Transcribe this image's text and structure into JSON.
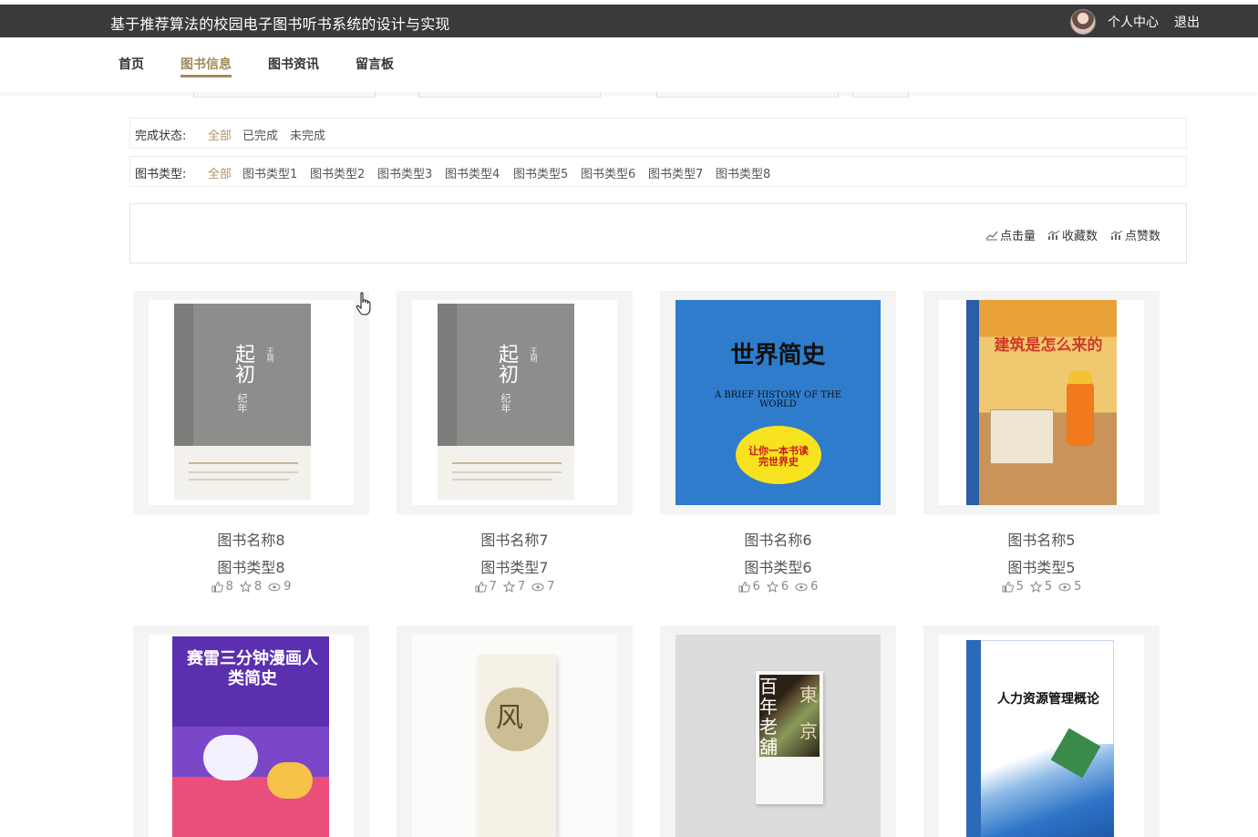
{
  "header": {
    "title": "基于推荐算法的校园电子图书听书系统的设计与实现",
    "user_center": "个人中心",
    "logout": "退出"
  },
  "nav": {
    "items": [
      "首页",
      "图书信息",
      "图书资讯",
      "留言板"
    ],
    "active": "图书信息"
  },
  "filters": {
    "status": {
      "label": "完成状态:",
      "options": [
        "全部",
        "已完成",
        "未完成"
      ],
      "selected": "全部"
    },
    "book_type": {
      "label": "图书类型:",
      "options": [
        "全部",
        "图书类型1",
        "图书类型2",
        "图书类型3",
        "图书类型4",
        "图书类型5",
        "图书类型6",
        "图书类型7",
        "图书类型8"
      ],
      "selected": "全部"
    }
  },
  "sort": {
    "clicks": "点击量",
    "favorites": "收藏数",
    "likes": "点赞数"
  },
  "books": [
    {
      "name": "图书名称8",
      "type": "图书类型8",
      "likes": "8",
      "favorites": "8",
      "views": "9",
      "cover_title": "起初",
      "cover_subtitle": "纪年",
      "cover_author": "王朔"
    },
    {
      "name": "图书名称7",
      "type": "图书类型7",
      "likes": "7",
      "favorites": "7",
      "views": "7",
      "cover_title": "起初",
      "cover_subtitle": "纪年",
      "cover_author": "王朔"
    },
    {
      "name": "图书名称6",
      "type": "图书类型6",
      "likes": "6",
      "favorites": "6",
      "views": "6",
      "cover_title": "世界简史",
      "cover_subtitle": "A BRIEF HISTORY OF THE WORLD",
      "cover_badge": "让你一本书读完世界史"
    },
    {
      "name": "图书名称5",
      "type": "图书类型5",
      "likes": "5",
      "favorites": "5",
      "views": "5",
      "cover_title": "建筑是怎么来的"
    },
    {
      "cover_title": "赛雷三分钟漫画人类简史"
    },
    {
      "cover_title": "风"
    },
    {
      "cover_title": "百年老舖",
      "cover_subtitle": "東京"
    },
    {
      "cover_title": "人力资源管理概论"
    }
  ],
  "colors": {
    "topbar": "#3a3a3a",
    "accent": "#a08a5c",
    "card_bg": "#f4f4f4"
  }
}
